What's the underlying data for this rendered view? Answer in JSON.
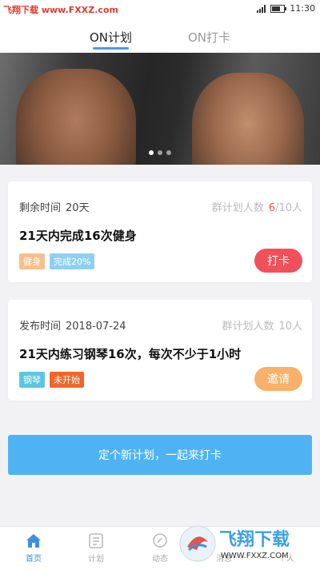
{
  "status_bar": {
    "watermark": "飞翔下载 www.FXXZ.com",
    "time": "11:30"
  },
  "tabs": [
    {
      "label": "ON计划",
      "active": true
    },
    {
      "label": "ON打卡",
      "active": false
    }
  ],
  "banner": {
    "page_count": 3,
    "active_index": 0
  },
  "cards": [
    {
      "meta_label": "剩余时间",
      "meta_value": "20天",
      "count_label": "群计划人数",
      "count_current": "6",
      "count_total": "/10人",
      "title": "21天内完成16次健身",
      "tags": [
        {
          "label": "健身",
          "color": "#f7bf8d"
        },
        {
          "label": "完成20%",
          "color": "#8fd0ef"
        }
      ],
      "button": {
        "label": "打卡",
        "color": "#f0505a"
      }
    },
    {
      "meta_label": "发布时间",
      "meta_value": "2018-07-24",
      "count_label": "群计划人数",
      "count_total": "10人",
      "title": "21天内练习钢琴16次，每次不少于1小时",
      "tags": [
        {
          "label": "钢琴",
          "color": "#5cc6e2"
        },
        {
          "label": "未开始",
          "color": "#f0662a"
        }
      ],
      "button": {
        "label": "邀请",
        "color": "#f7b168"
      }
    }
  ],
  "cta": {
    "label": "定个新计划，一起来打卡"
  },
  "bottom_nav": [
    {
      "label": "首页",
      "icon": "home-icon",
      "active": true
    },
    {
      "label": "计划",
      "icon": "plan-icon",
      "active": false
    },
    {
      "label": "动态",
      "icon": "feed-icon",
      "active": false
    },
    {
      "label": "消息",
      "icon": "message-icon",
      "active": false
    },
    {
      "label": "个人",
      "icon": "profile-icon",
      "active": false
    }
  ],
  "watermark": {
    "brand": "飞翔下载",
    "url": "WWW.FXXZ.COM"
  },
  "colors": {
    "accent": "#4a9be8",
    "cta": "#4fb3f3",
    "nav_active": "#3d8fe0"
  }
}
